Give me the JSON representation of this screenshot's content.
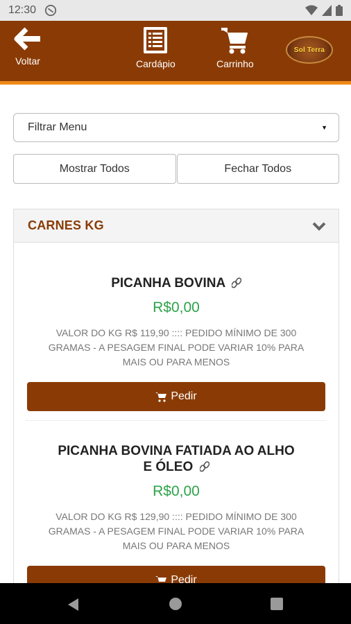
{
  "status": {
    "time": "12:30"
  },
  "topbar": {
    "back_label": "Voltar",
    "menu_label": "Cardápio",
    "cart_label": "Carrinho",
    "logo_text": "Sol Terra",
    "bar_color": "#8a3b05",
    "accent_color": "#ee8a17"
  },
  "filter": {
    "value": "Filtrar Menu"
  },
  "actions": {
    "show_all": "Mostrar Todos",
    "close_all": "Fechar Todos"
  },
  "category": {
    "title": "CARNES KG"
  },
  "products": [
    {
      "name": "PICANHA BOVINA",
      "price": "R$0,00",
      "desc_lines": [
        "VALOR DO KG R$ 119,90 :::: PEDIDO MÍNIMO DE 300",
        "GRAMAS - A PESAGEM FINAL PODE VARIAR 10% PARA",
        "MAIS OU PARA MENOS"
      ],
      "button": "Pedir"
    },
    {
      "name_lines": [
        "PICANHA BOVINA FATIADA AO ALHO",
        "E ÓLEO"
      ],
      "price": "R$0,00",
      "desc_lines": [
        "VALOR DO KG R$ 129,90 :::: PEDIDO MÍNIMO DE 300",
        "GRAMAS - A PESAGEM FINAL PODE VARIAR 10% PARA",
        "MAIS OU PARA MENOS"
      ],
      "button": "Pedir"
    }
  ]
}
